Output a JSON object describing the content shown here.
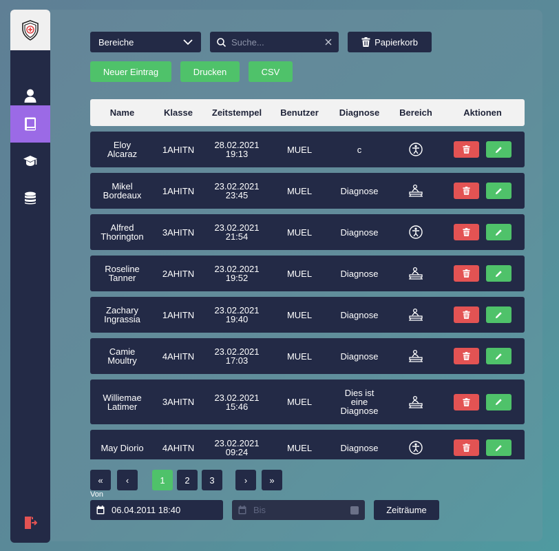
{
  "colors": {
    "sidebar": "#232a46",
    "active_nav": "#9b6ae6",
    "green": "#4fc26a",
    "red": "#e35353"
  },
  "sidebar": {
    "items": [
      {
        "icon": "user-icon"
      },
      {
        "icon": "book-icon",
        "active": true
      },
      {
        "icon": "graduation-cap-icon"
      },
      {
        "icon": "database-icon"
      }
    ],
    "logout_icon": "logout-icon"
  },
  "toolbar": {
    "area_select": "Bereiche",
    "search_placeholder": "Suche...",
    "trash_label": "Papierkorb",
    "new_entry_label": "Neuer Eintrag",
    "print_label": "Drucken",
    "csv_label": "CSV"
  },
  "table": {
    "headers": [
      "Name",
      "Klasse",
      "Zeitstempel",
      "Benutzer",
      "Diagnose",
      "Bereich",
      "Aktionen"
    ],
    "rows": [
      {
        "name_1": "Eloy",
        "name_2": "Alcaraz",
        "klasse": "1AHITN",
        "date": "28.02.2021",
        "time": "19:13",
        "benutzer": "MUEL",
        "diag_1": "c",
        "diag_2": "",
        "diag_3": "",
        "bereich": "body-icon"
      },
      {
        "name_1": "Mikel",
        "name_2": "Bordeaux",
        "klasse": "1AHITN",
        "date": "23.02.2021",
        "time": "23:45",
        "benutzer": "MUEL",
        "diag_1": "Diagnose",
        "diag_2": "",
        "diag_3": "",
        "bereich": "patient-bed-icon"
      },
      {
        "name_1": "Alfred",
        "name_2": "Thorington",
        "klasse": "3AHITN",
        "date": "23.02.2021",
        "time": "21:54",
        "benutzer": "MUEL",
        "diag_1": "Diagnose",
        "diag_2": "",
        "diag_3": "",
        "bereich": "body-icon"
      },
      {
        "name_1": "Roseline",
        "name_2": "Tanner",
        "klasse": "2AHITN",
        "date": "23.02.2021",
        "time": "19:52",
        "benutzer": "MUEL",
        "diag_1": "Diagnose",
        "diag_2": "",
        "diag_3": "",
        "bereich": "patient-bed-icon"
      },
      {
        "name_1": "Zachary",
        "name_2": "Ingrassia",
        "klasse": "1AHITN",
        "date": "23.02.2021",
        "time": "19:40",
        "benutzer": "MUEL",
        "diag_1": "Diagnose",
        "diag_2": "",
        "diag_3": "",
        "bereich": "patient-bed-icon"
      },
      {
        "name_1": "Camie",
        "name_2": "Moultry",
        "klasse": "4AHITN",
        "date": "23.02.2021",
        "time": "17:03",
        "benutzer": "MUEL",
        "diag_1": "Diagnose",
        "diag_2": "",
        "diag_3": "",
        "bereich": "patient-bed-icon"
      },
      {
        "name_1": "Williemae",
        "name_2": "Latimer",
        "klasse": "3AHITN",
        "date": "23.02.2021",
        "time": "15:46",
        "benutzer": "MUEL",
        "diag_1": "Dies ist",
        "diag_2": "eine",
        "diag_3": "Diagnose",
        "bereich": "patient-bed-icon"
      },
      {
        "name_1": "May Diorio",
        "name_2": "",
        "klasse": "4AHITN",
        "date": "23.02.2021",
        "time": "09:24",
        "benutzer": "MUEL",
        "diag_1": "Diagnose",
        "diag_2": "",
        "diag_3": "",
        "bereich": "body-icon"
      }
    ]
  },
  "pagination": {
    "first": "«",
    "prev": "‹",
    "pages": [
      "1",
      "2",
      "3"
    ],
    "current_page": "1",
    "next": "›",
    "last": "»"
  },
  "filter": {
    "from_label": "Von",
    "from_value": "06.04.2011 18:40",
    "to_placeholder": "Bis",
    "periods_label": "Zeiträume"
  }
}
